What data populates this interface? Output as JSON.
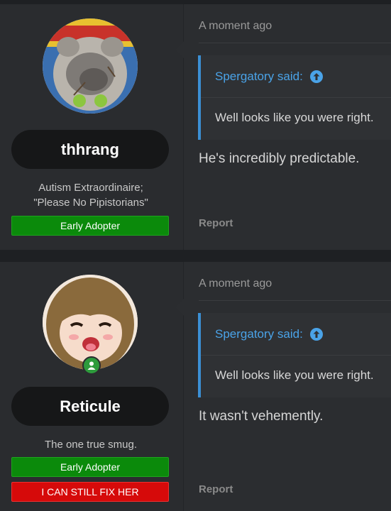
{
  "posts": [
    {
      "username": "thhrang",
      "user_title_line1": "Autism Extraordinaire;",
      "user_title_line2": "\"Please No Pipistorians\"",
      "badges": [
        "Early Adopter"
      ],
      "timestamp": "A moment ago",
      "quote_author": "Spergatory said:",
      "quote_text": "Well looks like you were right.",
      "message": "He's incredibly predictable.",
      "report_label": "Report"
    },
    {
      "username": "Reticule",
      "user_title_line1": "The one true smug.",
      "badges": [
        "Early Adopter",
        "I CAN STILL FIX HER"
      ],
      "timestamp": "A moment ago",
      "quote_author": "Spergatory said:",
      "quote_text": "Well looks like you were right.",
      "message": "It wasn't vehemently.",
      "report_label": "Report",
      "online": true
    }
  ],
  "colors": {
    "accent": "#4aa3e8",
    "badge_green": "#0b8a0b",
    "badge_red": "#d60a0a",
    "online": "#2d9b3c"
  }
}
